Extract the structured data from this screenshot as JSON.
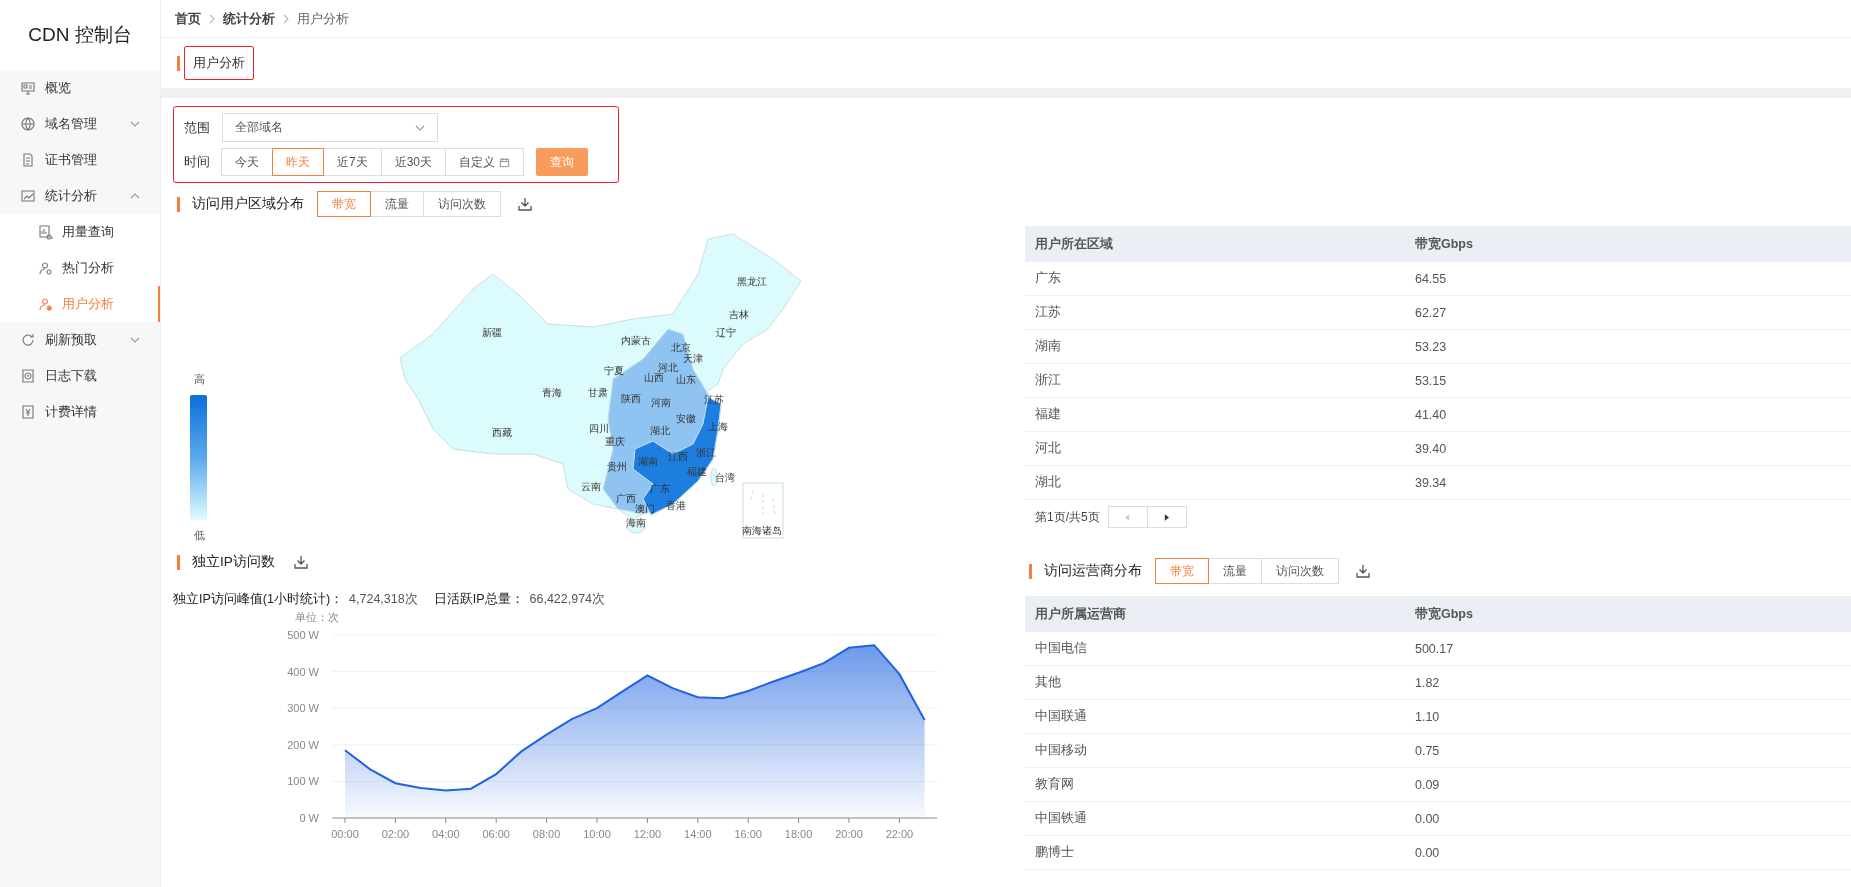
{
  "sidebar": {
    "logo": "CDN 控制台",
    "items": [
      {
        "label": "概览",
        "kind": "plain",
        "selected": false
      },
      {
        "label": "域名管理",
        "kind": "group",
        "selected": false,
        "expanded": false
      },
      {
        "label": "证书管理",
        "kind": "plain",
        "selected": false
      },
      {
        "label": "统计分析",
        "kind": "group",
        "selected": false,
        "expanded": true,
        "children": [
          {
            "label": "用量查询",
            "selected": false
          },
          {
            "label": "热门分析",
            "selected": false
          },
          {
            "label": "用户分析",
            "selected": true
          }
        ]
      },
      {
        "label": "刷新预取",
        "kind": "group",
        "selected": false,
        "expanded": false
      },
      {
        "label": "日志下载",
        "kind": "plain",
        "selected": false
      },
      {
        "label": "计费详情",
        "kind": "plain",
        "selected": false
      }
    ]
  },
  "breadcrumb": [
    "首页",
    "统计分析",
    "用户分析"
  ],
  "page_title": "用户分析",
  "filter": {
    "scope_label": "范围",
    "scope_value": "全部域名",
    "time_label": "时间",
    "time_options": [
      {
        "label": "今天",
        "kind": "preset",
        "selected": false
      },
      {
        "label": "昨天",
        "kind": "preset",
        "selected": true
      },
      {
        "label": "近7天",
        "kind": "preset",
        "selected": false
      },
      {
        "label": "近30天",
        "kind": "preset",
        "selected": false
      },
      {
        "label": "自定义",
        "kind": "custom",
        "selected": false
      }
    ],
    "query_button": "查询"
  },
  "region": {
    "title": "访问用户区域分布",
    "tabs": [
      {
        "label": "带宽",
        "selected": true
      },
      {
        "label": "流量",
        "selected": false
      },
      {
        "label": "访问次数",
        "selected": false
      }
    ],
    "map": {
      "legend_high": "高",
      "legend_low": "低",
      "labels": [
        "黑龙江",
        "吉林",
        "新疆",
        "辽宁",
        "内蒙古",
        "北京",
        "天津",
        "河北",
        "宁夏",
        "山西",
        "山东",
        "青海",
        "甘肃",
        "陕西",
        "河南",
        "江苏",
        "安徽",
        "上海",
        "西藏",
        "四川",
        "湖北",
        "重庆",
        "浙江",
        "湖南",
        "江西",
        "贵州",
        "福建",
        "台湾",
        "云南",
        "广东",
        "广西",
        "澳门",
        "香港",
        "海南",
        "南海诸岛"
      ]
    },
    "table": {
      "columns": [
        "用户所在区域",
        "带宽Gbps"
      ],
      "rows": [
        [
          "广东",
          "64.55"
        ],
        [
          "江苏",
          "62.27"
        ],
        [
          "湖南",
          "53.23"
        ],
        [
          "浙江",
          "53.15"
        ],
        [
          "福建",
          "41.40"
        ],
        [
          "河北",
          "39.40"
        ],
        [
          "湖北",
          "39.34"
        ]
      ]
    },
    "pagination": {
      "text": "第1页/共5页",
      "prev_disabled": true,
      "next_disabled": false
    }
  },
  "ip": {
    "title": "独立IP访问数",
    "stats": [
      {
        "label": "独立IP访问峰值(1小时统计)：",
        "value": "4,724,318次"
      },
      {
        "label": "日活跃IP总量：",
        "value": "66,422,974次"
      }
    ],
    "chart_data": {
      "type": "area",
      "ylabel": "单位：次",
      "x": [
        0,
        1,
        2,
        3,
        4,
        5,
        6,
        7,
        8,
        9,
        10,
        11,
        12,
        13,
        14,
        15,
        16,
        17,
        18,
        19,
        20,
        21,
        22,
        23
      ],
      "xticks": [
        {
          "value": 0,
          "label": "00:00"
        },
        {
          "value": 2,
          "label": "02:00"
        },
        {
          "value": 4,
          "label": "04:00"
        },
        {
          "value": 6,
          "label": "06:00"
        },
        {
          "value": 8,
          "label": "08:00"
        },
        {
          "value": 10,
          "label": "10:00"
        },
        {
          "value": 12,
          "label": "12:00"
        },
        {
          "value": 14,
          "label": "14:00"
        },
        {
          "value": 16,
          "label": "16:00"
        },
        {
          "value": 18,
          "label": "18:00"
        },
        {
          "value": 20,
          "label": "20:00"
        },
        {
          "value": 22,
          "label": "22:00"
        }
      ],
      "xlim": [
        -0.5,
        23.5
      ],
      "ylim": [
        0,
        500
      ],
      "grid": true,
      "yticks": [
        {
          "value": 0,
          "label": "0 W"
        },
        {
          "value": 100,
          "label": "100 W"
        },
        {
          "value": 200,
          "label": "200 W"
        },
        {
          "value": 300,
          "label": "300 W"
        },
        {
          "value": 400,
          "label": "400 W"
        },
        {
          "value": 500,
          "label": "500 W"
        }
      ],
      "series": [
        {
          "color": "#1f63e0",
          "values": [
            185,
            133,
            95,
            82,
            75,
            80,
            120,
            182,
            228,
            270,
            300,
            345,
            390,
            355,
            330,
            327,
            347,
            373,
            397,
            423,
            465,
            472,
            393,
            268
          ]
        }
      ]
    }
  },
  "operator": {
    "title": "访问运营商分布",
    "tabs": [
      {
        "label": "带宽",
        "selected": true
      },
      {
        "label": "流量",
        "selected": false
      },
      {
        "label": "访问次数",
        "selected": false
      }
    ],
    "table": {
      "columns": [
        "用户所属运营商",
        "带宽Gbps"
      ],
      "rows": [
        [
          "中国电信",
          "500.17"
        ],
        [
          "其他",
          "1.82"
        ],
        [
          "中国联通",
          "1.10"
        ],
        [
          "中国移动",
          "0.75"
        ],
        [
          "教育网",
          "0.09"
        ],
        [
          "中国铁通",
          "0.00"
        ],
        [
          "鹏博士",
          "0.00"
        ]
      ]
    }
  }
}
